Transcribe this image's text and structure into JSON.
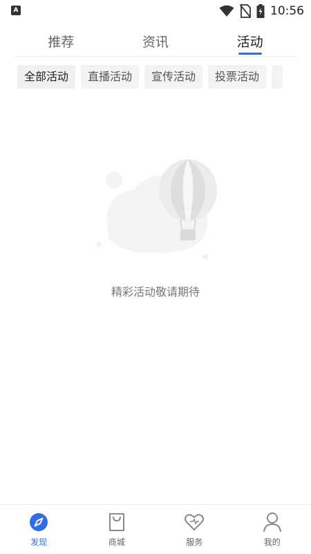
{
  "status_bar": {
    "app_badge": "A",
    "time": "10:56",
    "icons": [
      "wifi-icon",
      "no-sim-icon",
      "battery-charging-icon"
    ]
  },
  "top_tabs": [
    {
      "label": "推荐",
      "active": false
    },
    {
      "label": "资讯",
      "active": false
    },
    {
      "label": "活动",
      "active": true
    }
  ],
  "filter_chips": [
    {
      "label": "全部活动",
      "selected": true
    },
    {
      "label": "直播活动",
      "selected": false
    },
    {
      "label": "宣传活动",
      "selected": false
    },
    {
      "label": "投票活动",
      "selected": false
    }
  ],
  "empty_state": {
    "illustration": "hot-air-balloon-icon",
    "message": "精彩活动敬请期待"
  },
  "bottom_nav": [
    {
      "label": "发现",
      "icon": "compass-icon",
      "active": true
    },
    {
      "label": "商城",
      "icon": "shopping-bag-icon",
      "active": false
    },
    {
      "label": "服务",
      "icon": "heart-icon",
      "active": false
    },
    {
      "label": "我的",
      "icon": "user-icon",
      "active": false
    }
  ],
  "colors": {
    "accent": "#2f6ee5",
    "chip_bg": "#f3f3f3",
    "text_muted": "#777777"
  }
}
